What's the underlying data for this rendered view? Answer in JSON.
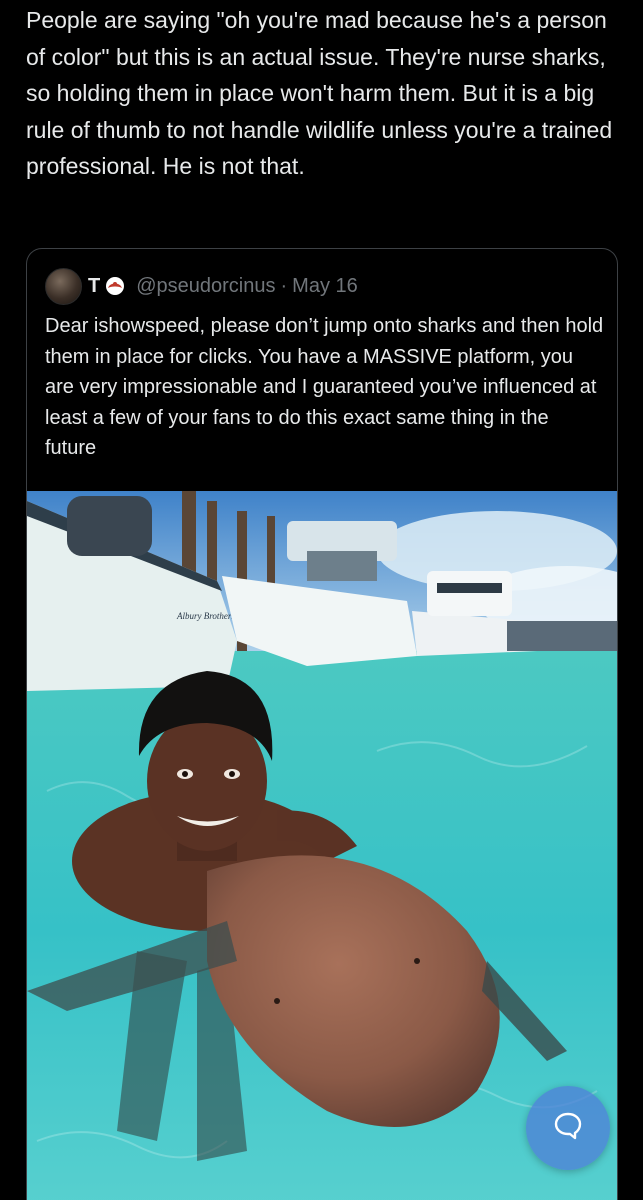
{
  "tweet": {
    "text": "People are saying \"oh you're mad because he's a person of color\" but this is an actual issue. They're nurse sharks, so holding them in place won't harm them. But it is a big rule of thumb to not handle wildlife unless you're a trained professional. He is not that."
  },
  "quoted_tweet": {
    "display_name": "T",
    "handle": "@pseudorcinus",
    "separator": "·",
    "date": "May 16",
    "text": "Dear ishowspeed, please don’t jump onto sharks and then hold them in place for clicks. You have a MASSIVE platform, you are very impressionable and I guaranteed you’ve influenced at least a few of your fans to do this exact same thing in the future",
    "media_description_icon": "photo",
    "boat_name": "Albury Brothers 23"
  },
  "icons": {
    "name_badge": "flag-icon",
    "reply_button": "chat-bubble-icon"
  },
  "colors": {
    "background": "#000000",
    "text": "#e7e9ea",
    "secondary_text": "#71767b",
    "border": "#3d4145",
    "fab": "#4e82d6",
    "water": "#38c3c4"
  }
}
